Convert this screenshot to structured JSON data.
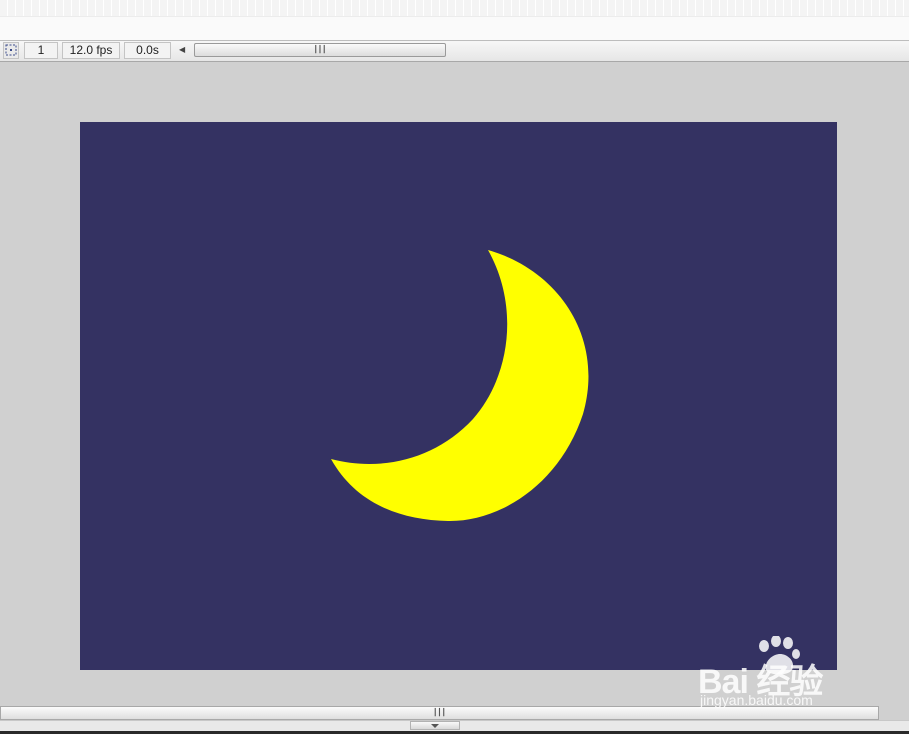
{
  "status_bar": {
    "frame_number": "1",
    "frame_rate": "12.0 fps",
    "elapsed_time": "0.0s"
  },
  "stage": {
    "background_color": "#343262",
    "moon_color": "#ffff00"
  },
  "watermark": {
    "brand": "Bai  经验",
    "url": "jingyan.baidu.com"
  },
  "icons": {
    "center_frame": "center-frame-icon",
    "scroll_grip": "grip-icon",
    "collapse": "chevron-down-icon",
    "brand_mark": "paw-icon"
  }
}
